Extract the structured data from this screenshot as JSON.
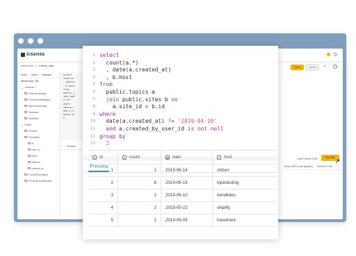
{
  "app": {
    "logo_text": "SISENSE",
    "breadcrumb": [
      "Warehouse",
      "▸",
      "a.demo_view"
    ],
    "save_label": "Save",
    "cancel_label": "Cancel",
    "close_glyph": "×"
  },
  "sidebar": {
    "tabs": [
      "Reset",
      "Tables",
      "Columns"
    ],
    "title": "Warehouse_DB",
    "tree": [
      {
        "label": "Schema 1",
        "depth": 0,
        "icon": "chevron-icon"
      },
      {
        "label": "ProductCategory",
        "depth": 1,
        "icon": "table-icon"
      },
      {
        "label": "ProductSubcategory",
        "depth": 1,
        "icon": "table-icon"
      },
      {
        "label": "SalesOrderDetail",
        "depth": 1,
        "icon": "table-icon"
      },
      {
        "label": "Customer",
        "depth": 1,
        "icon": "table-icon"
      },
      {
        "label": "Territories",
        "depth": 1,
        "icon": "table-icon"
      },
      {
        "label": "Public",
        "depth": 0,
        "icon": "chevron-icon"
      },
      {
        "label": "Product",
        "depth": 1,
        "icon": "table-icon"
      },
      {
        "label": "Purchases",
        "depth": 1,
        "icon": "table-icon"
      },
      {
        "label": "id",
        "depth": 2,
        "icon": "column-icon"
      },
      {
        "label": "user_id",
        "depth": 2,
        "icon": "column-icon"
      },
      {
        "label": "price",
        "depth": 2,
        "icon": "column-icon"
      },
      {
        "label": "platform",
        "depth": 2,
        "icon": "column-icon"
      },
      {
        "label": "created_at",
        "depth": 2,
        "icon": "column-icon"
      },
      {
        "label": "ProductPurchases",
        "depth": 1,
        "icon": "table-icon"
      },
      {
        "label": "ProductPurchaseView",
        "depth": 1,
        "icon": "table-icon"
      }
    ]
  },
  "background_editor": {
    "snippet": [
      "select",
      " count(a.",
      " , date(a",
      " , b.host",
      "from",
      " public.t",
      " join pub",
      "  a.sit",
      "where",
      " date(a.c",
      " and a.cr",
      "group by",
      " 2"
    ],
    "preview_label": "Preview",
    "limit_label": "Limit Preview 1000",
    "run_label": "Run SQL",
    "rows_label": "Rows 5000 (Limit Applied)",
    "runtime_label": "Runtime 0.31s"
  },
  "editor": {
    "lines": [
      {
        "n": "1",
        "parts": [
          {
            "t": "select",
            "c": "kw"
          }
        ]
      },
      {
        "n": "2",
        "parts": [
          {
            "t": "  count(a.*)",
            "c": ""
          }
        ]
      },
      {
        "n": "3",
        "parts": [
          {
            "t": "  , date(a.created_at)",
            "c": ""
          }
        ]
      },
      {
        "n": "4",
        "parts": [
          {
            "t": "  , b.host",
            "c": ""
          }
        ]
      },
      {
        "n": "5",
        "parts": [
          {
            "t": "from",
            "c": "kw"
          }
        ]
      },
      {
        "n": "6",
        "parts": [
          {
            "t": "  public.topics a",
            "c": ""
          }
        ]
      },
      {
        "n": "7",
        "parts": [
          {
            "t": "  ",
            "c": ""
          },
          {
            "t": "join",
            "c": "kw"
          },
          {
            "t": " public.sites b ",
            "c": ""
          },
          {
            "t": "on",
            "c": "kw"
          }
        ]
      },
      {
        "n": "8",
        "parts": [
          {
            "t": "    a.site_id = b.id",
            "c": ""
          }
        ]
      },
      {
        "n": "9",
        "parts": [
          {
            "t": "where",
            "c": "kw"
          }
        ]
      },
      {
        "n": "10",
        "parts": [
          {
            "t": "  date(a.created_at) != ",
            "c": ""
          },
          {
            "t": "'2019-04-10'",
            "c": "str"
          }
        ]
      },
      {
        "n": "11",
        "parts": [
          {
            "t": "  ",
            "c": ""
          },
          {
            "t": "and",
            "c": "kw"
          },
          {
            "t": " a.created_by_user_id ",
            "c": ""
          },
          {
            "t": "is not null",
            "c": "kw"
          }
        ]
      },
      {
        "n": "12",
        "parts": [
          {
            "t": "group by",
            "c": "kw"
          }
        ]
      },
      {
        "n": "13",
        "parts": [
          {
            "t": "  ",
            "c": ""
          },
          {
            "t": "2",
            "c": "num"
          }
        ]
      }
    ]
  },
  "preview": {
    "title": "Preview",
    "columns": [
      {
        "label": "id",
        "icon": "number-type-icon",
        "icon_glyph": "#"
      },
      {
        "label": "count",
        "icon": "number-type-icon",
        "icon_glyph": "#"
      },
      {
        "label": "date",
        "icon": "date-type-icon",
        "icon_glyph": "▦"
      },
      {
        "label": "host",
        "icon": "text-type-icon",
        "icon_glyph": "≡"
      }
    ],
    "rows": [
      [
        "1",
        "1",
        "2019-06-14",
        "citizen"
      ],
      [
        "2",
        "6",
        "2019-06-19",
        "topictesting"
      ],
      [
        "3",
        "1",
        "2019-06-10",
        "trendkites"
      ],
      [
        "4",
        "2",
        "2019-05-22",
        "shiplify"
      ],
      [
        "5",
        "1",
        "2019-06-05",
        "travelnest"
      ]
    ]
  },
  "colors": {
    "window_frame": "#7f9ebd",
    "accent_yellow": "#f2b400",
    "preview_blue": "#4a8ab8",
    "keyword": "#a626a4",
    "string": "#e45649",
    "number": "#c18401"
  }
}
